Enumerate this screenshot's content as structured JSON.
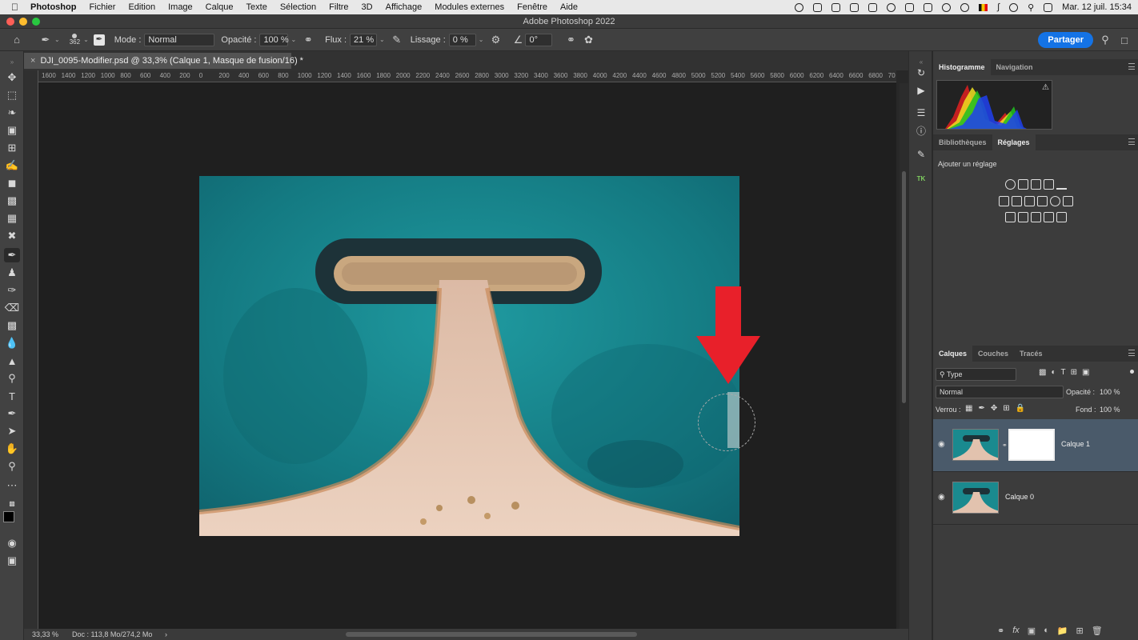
{
  "menubar": {
    "app": "Photoshop",
    "items": [
      "Fichier",
      "Edition",
      "Image",
      "Calque",
      "Texte",
      "Sélection",
      "Filtre",
      "3D",
      "Affichage",
      "Modules externes",
      "Fenêtre",
      "Aide"
    ],
    "clock": "Mar. 12 juil.  15:34"
  },
  "window": {
    "title": "Adobe Photoshop 2022"
  },
  "options": {
    "brush_size": "362",
    "mode_label": "Mode :",
    "mode_value": "Normal",
    "opacity_label": "Opacité :",
    "opacity_value": "100 %",
    "flow_label": "Flux :",
    "flow_value": "21 %",
    "smoothing_label": "Lissage :",
    "smoothing_value": "0 %",
    "angle_value": "0°",
    "share_label": "Partager"
  },
  "document": {
    "tab_title": "DJI_0095-Modifier.psd @ 33,3% (Calque 1, Masque de fusion/16) *",
    "zoom": "33,33 %",
    "doc_info": "Doc : 113,8 Mo/274,2 Mo"
  },
  "ruler": {
    "labels": [
      "1600",
      "1400",
      "1200",
      "1000",
      "800",
      "600",
      "400",
      "200",
      "0",
      "200",
      "400",
      "600",
      "800",
      "1000",
      "1200",
      "1400",
      "1600",
      "1800",
      "2000",
      "2200",
      "2400",
      "2600",
      "2800",
      "3000",
      "3200",
      "3400",
      "3600",
      "3800",
      "4000",
      "4200",
      "4400",
      "4600",
      "4800",
      "5000",
      "5200",
      "5400",
      "5600",
      "5800",
      "6000",
      "6200",
      "6400",
      "6600",
      "6800",
      "70"
    ]
  },
  "panels": {
    "top_tabs": [
      "Histogramme",
      "Navigation"
    ],
    "mid_tabs": [
      "Bibliothèques",
      "Réglages"
    ],
    "adjust_heading": "Ajouter un réglage",
    "layers_tabs": [
      "Calques",
      "Couches",
      "Tracés"
    ],
    "filter_value": "Type",
    "blend_mode": "Normal",
    "opacity_label": "Opacité :",
    "opacity_value": "100 %",
    "lock_label": "Verrou :",
    "fill_label": "Fond :",
    "fill_value": "100 %",
    "layers": [
      {
        "name": "Calque 1",
        "selected": true
      },
      {
        "name": "Calque 0",
        "selected": false
      }
    ]
  },
  "colors": {
    "accent": "#1473e6",
    "arrow": "#e8202a",
    "water": "#1a8a8f",
    "sand": "#e6c4ad"
  }
}
